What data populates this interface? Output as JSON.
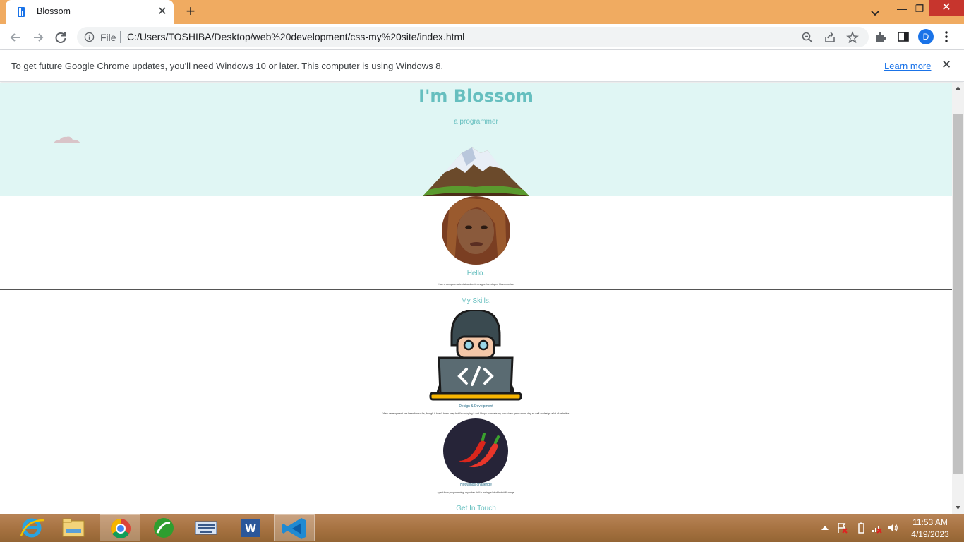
{
  "browser": {
    "tab_title": "Blossom",
    "url_prefix": "File",
    "url": "C:/Users/TOSHIBA/Desktop/web%20development/css-my%20site/index.html",
    "profile_initial": "D",
    "info_message": "To get future Google Chrome updates, you'll need Windows 10 or later. This computer is using Windows 8.",
    "info_link": "Learn more"
  },
  "page": {
    "title": "I'm Blossom",
    "subtitle": "a programmer",
    "hello_heading": "Hello.",
    "hello_text": "I am a computer scientist and web designer/developer. I love movies",
    "skills_heading": "My Skills.",
    "skill1_heading": "Design & Develpment",
    "skill1_text": "Web development has been fun so far, though it hasn't been easy but I'm enjoying it and I hope to create my own video game some day as well as design a lot of websites",
    "skill2_heading": "Hot wings challenge",
    "skill2_text": "Apart from programming, my other skill is eating a lot of hot chilli wings.",
    "contact_heading": "Get In Touch"
  },
  "taskbar": {
    "time": "11:53 AM",
    "date": "4/19/2023"
  },
  "colors": {
    "accent": "#66bfbf",
    "hero_bg": "#e0f6f4",
    "chrome_frame": "#f0ab61"
  }
}
